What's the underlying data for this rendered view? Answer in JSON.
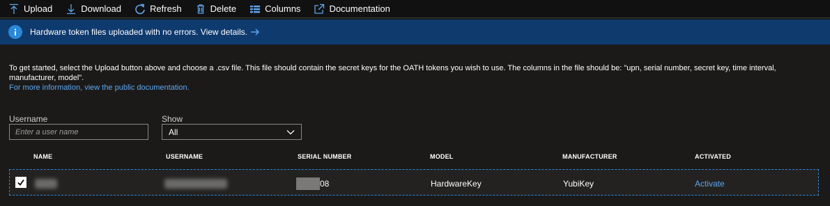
{
  "toolbar": {
    "upload": "Upload",
    "download": "Download",
    "refresh": "Refresh",
    "delete": "Delete",
    "columns": "Columns",
    "documentation": "Documentation"
  },
  "banner": {
    "message": "Hardware token files uploaded with no errors. View details."
  },
  "description": {
    "text": "To get started, select the Upload button above and choose a .csv file. This file should contain the secret keys for the OATH tokens you wish to use. The columns in the file should be: \"upn, serial number, secret key, time interval, manufacturer, model\".",
    "link": "For more information, view the public documentation."
  },
  "filters": {
    "username_label": "Username",
    "username_placeholder": "Enter a user name",
    "username_value": "",
    "show_label": "Show",
    "show_selected": "All"
  },
  "table": {
    "columns": [
      "NAME",
      "USERNAME",
      "SERIAL NUMBER",
      "MODEL",
      "MANUFACTURER",
      "ACTIVATED"
    ],
    "rows": [
      {
        "checked": true,
        "name": "",
        "username": "",
        "serial_suffix": "08",
        "model": "HardwareKey",
        "manufacturer": "YubiKey",
        "activated": "Activate"
      }
    ]
  },
  "colors": {
    "background": "#1b1a19",
    "banner": "#0e3a6e",
    "accent": "#2b88d8",
    "link": "#5ea7f0"
  }
}
